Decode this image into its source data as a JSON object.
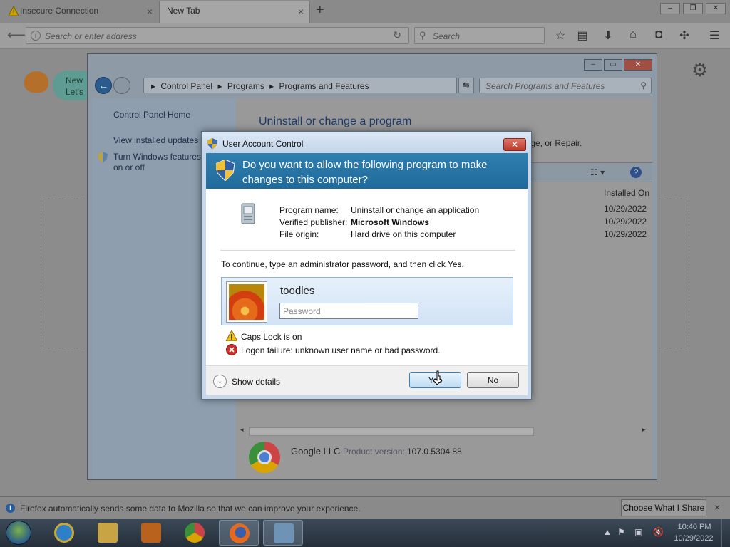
{
  "browser": {
    "tabs": [
      {
        "label": "Insecure Connection",
        "close": "×"
      },
      {
        "label": "New Tab",
        "close": "×"
      }
    ],
    "new_tab_plus": "+",
    "window_controls": [
      "–",
      "❐",
      "✕"
    ],
    "address_placeholder": "Search or enter address",
    "search_placeholder": "Search",
    "newtab_bubble": [
      "New",
      "Let's"
    ]
  },
  "control_panel": {
    "breadcrumb": [
      "Control Panel",
      "Programs",
      "Programs and Features"
    ],
    "search_placeholder": "Search Programs and Features",
    "sidebar": {
      "home": "Control Panel Home",
      "updates": "View installed updates",
      "features": "Turn Windows features on or off"
    },
    "heading": "Uninstall or change a program",
    "desc_tail": "ange, or Repair.",
    "column_installed_on": "Installed On",
    "dates": [
      "10/29/2022",
      "10/29/2022",
      "10/29/2022"
    ],
    "detail": {
      "publisher": "Google LLC",
      "version_label": "Product version:",
      "version": "107.0.5304.88"
    }
  },
  "uac": {
    "title": "User Account Control",
    "question": "Do you want to allow the following program to make changes to this computer?",
    "program_name_label": "Program name:",
    "program_name": "Uninstall or change an application",
    "publisher_label": "Verified publisher:",
    "publisher": "Microsoft Windows",
    "origin_label": "File origin:",
    "origin": "Hard drive on this computer",
    "instruction": "To continue, type an administrator password, and then click Yes.",
    "username": "toodles",
    "password_placeholder": "Password",
    "password_value": "",
    "caps_lock_msg": "Caps Lock is on",
    "logon_failure_msg": "Logon failure: unknown user name or bad password.",
    "show_details": "Show details",
    "yes": "Yes",
    "no": "No"
  },
  "notification": {
    "text": "Firefox automatically sends some data to Mozilla so that we can improve your experience.",
    "button": "Choose What I Share",
    "close": "×"
  },
  "taskbar": {
    "time": "10:40 PM",
    "date": "10/29/2022"
  },
  "colors": {
    "uac_banner": "#1f6a9a",
    "cp_link": "#1e2e48",
    "taskbar": "#252f3a"
  }
}
